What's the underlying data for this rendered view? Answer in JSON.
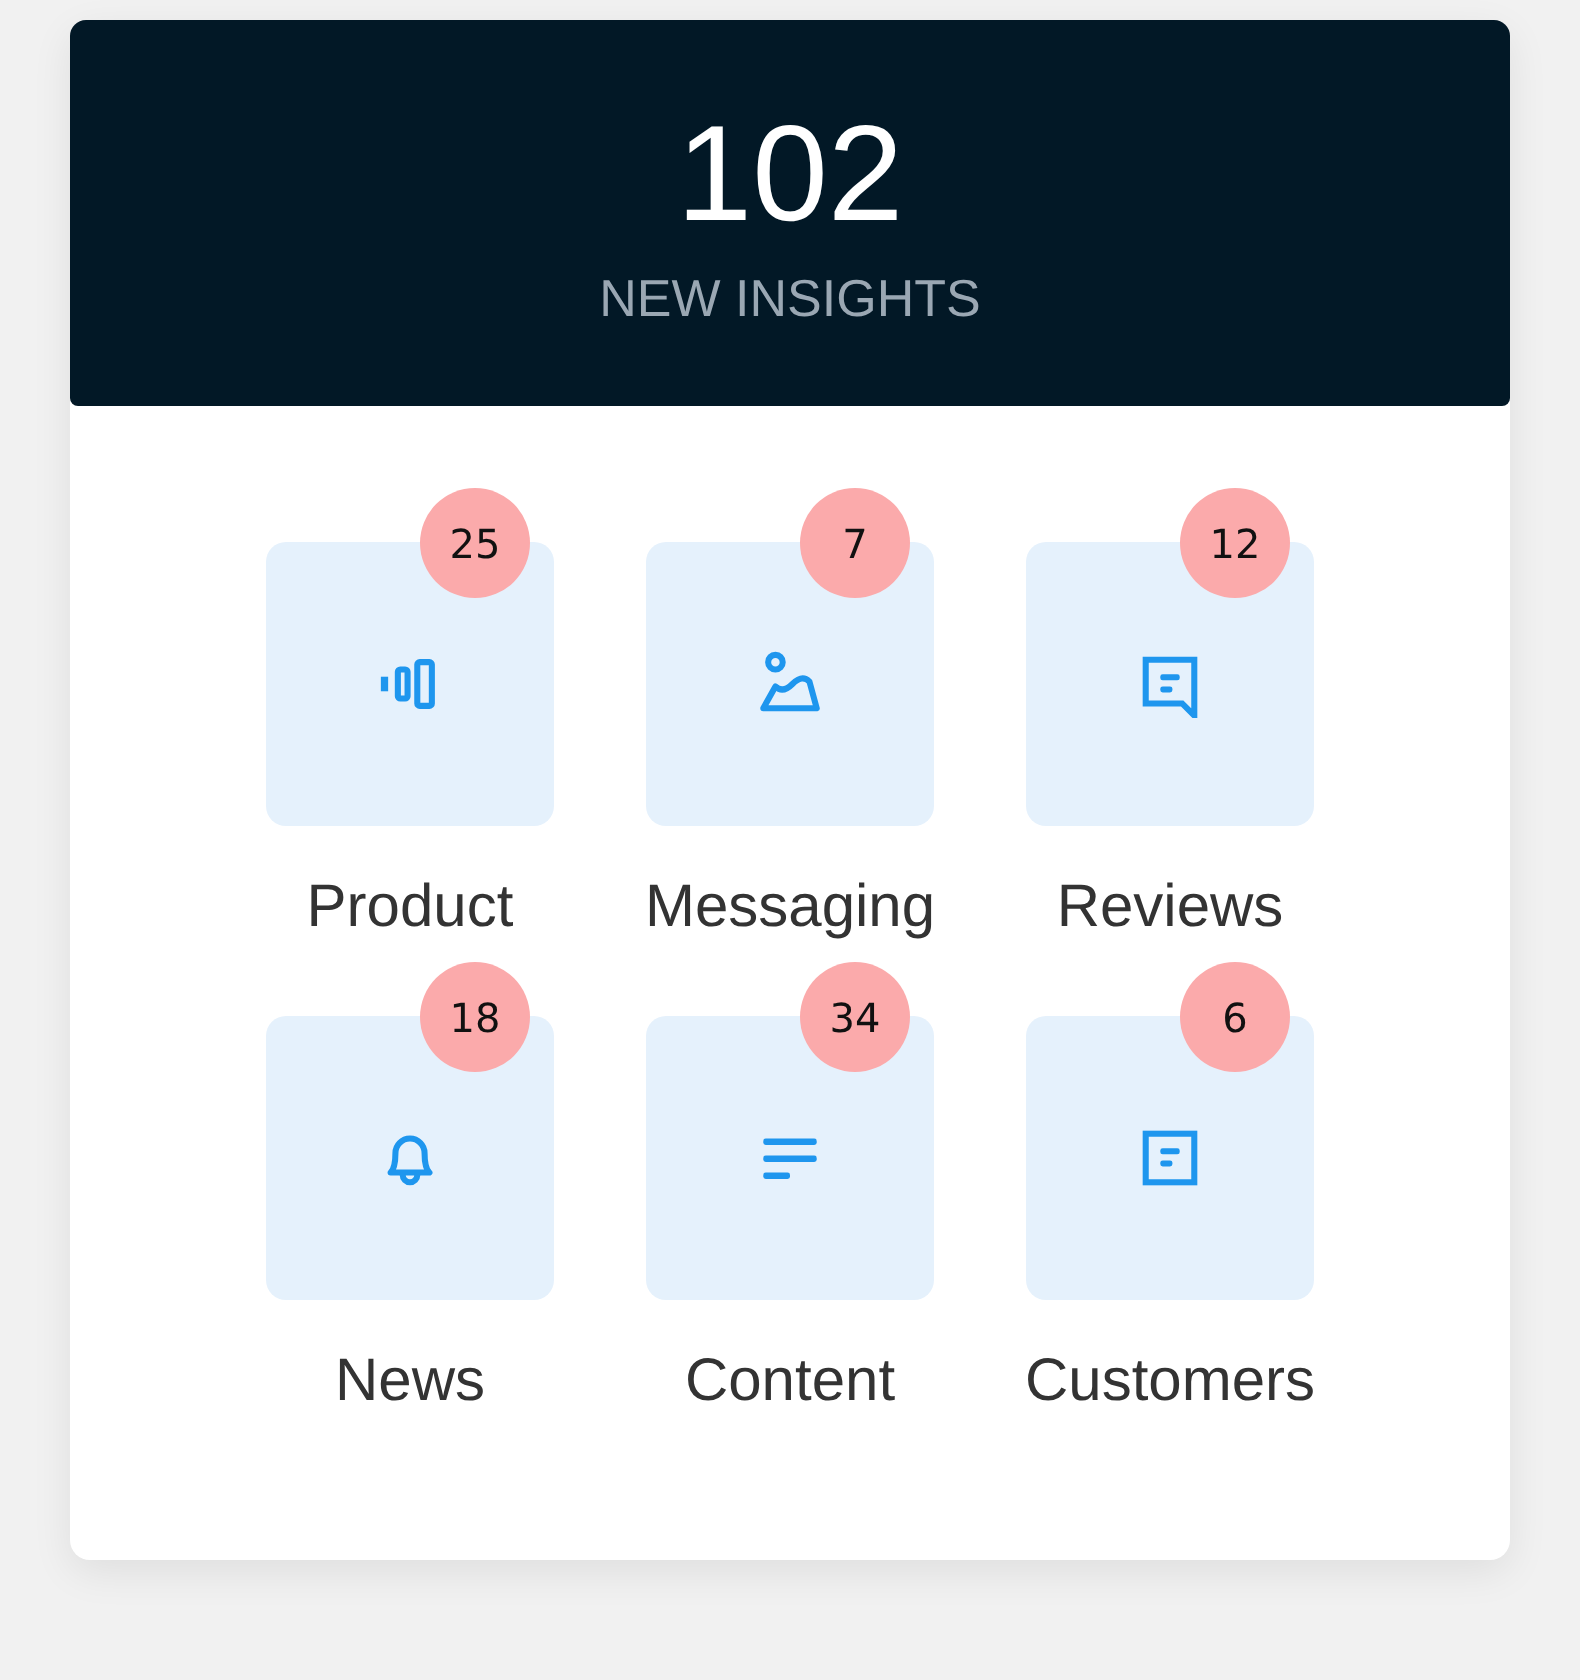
{
  "header": {
    "count": "102",
    "label": "NEW INSIGHTS"
  },
  "categories": [
    {
      "label": "Product",
      "badge": "25"
    },
    {
      "label": "Messaging",
      "badge": "7"
    },
    {
      "label": "Reviews",
      "badge": "12"
    },
    {
      "label": "News",
      "badge": "18"
    },
    {
      "label": "Content",
      "badge": "34"
    },
    {
      "label": "Customers",
      "badge": "6"
    }
  ]
}
